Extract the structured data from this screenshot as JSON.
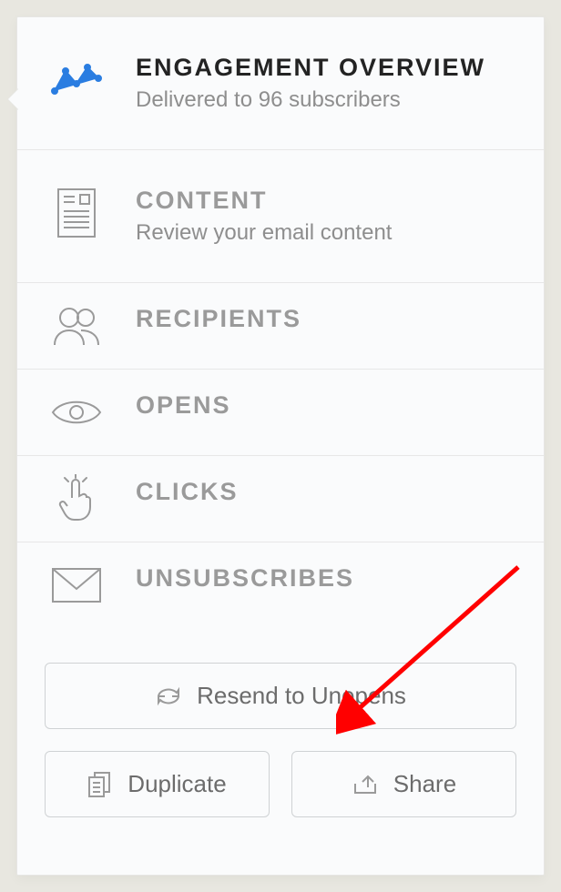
{
  "nav": {
    "engagement": {
      "title": "ENGAGEMENT OVERVIEW",
      "sub": "Delivered to 96 subscribers"
    },
    "content": {
      "title": "CONTENT",
      "sub": "Review your email content"
    },
    "recipients": {
      "title": "RECIPIENTS"
    },
    "opens": {
      "title": "OPENS"
    },
    "clicks": {
      "title": "CLICKS"
    },
    "unsubs": {
      "title": "UNSUBSCRIBES"
    }
  },
  "buttons": {
    "resend": "Resend to Unopens",
    "duplicate": "Duplicate",
    "share": "Share"
  }
}
